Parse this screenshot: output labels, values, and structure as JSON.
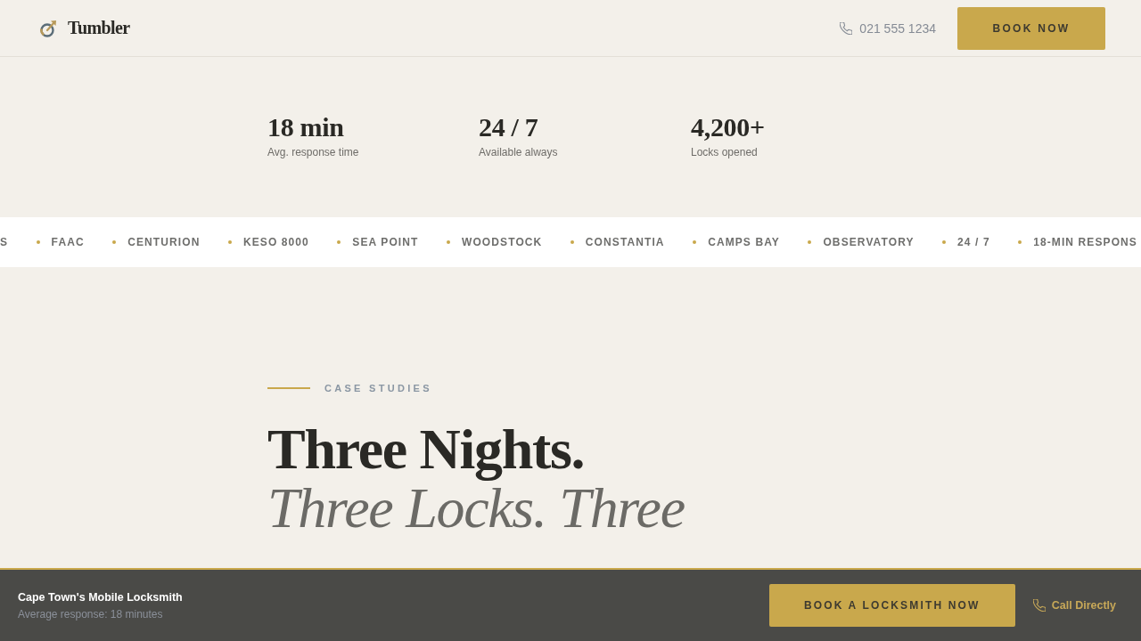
{
  "header": {
    "brand": "Tumbler",
    "phone": "021 555 1234",
    "cta": "BOOK NOW"
  },
  "stats": [
    {
      "value": "18 min",
      "label": "Avg. response time"
    },
    {
      "value": "24 / 7",
      "label": "Available always"
    },
    {
      "value": "4,200+",
      "label": "Locks opened"
    }
  ],
  "marquee": {
    "items": [
      "S",
      "FAAC",
      "CENTURION",
      "KESO 8000",
      "SEA POINT",
      "WOODSTOCK",
      "CONSTANTIA",
      "CAMPS BAY",
      "OBSERVATORY",
      "24 / 7",
      "18-MIN RESPONS"
    ]
  },
  "case_studies": {
    "eyebrow": "CASE STUDIES",
    "title": "Three Nights.",
    "subtitle": "Three Locks. Three"
  },
  "sticky_bar": {
    "title": "Cape Town's Mobile Locksmith",
    "subtitle": "Average response: 18 minutes",
    "primary_button": "BOOK A LOCKSMITH NOW",
    "call_link": "Call Directly"
  }
}
